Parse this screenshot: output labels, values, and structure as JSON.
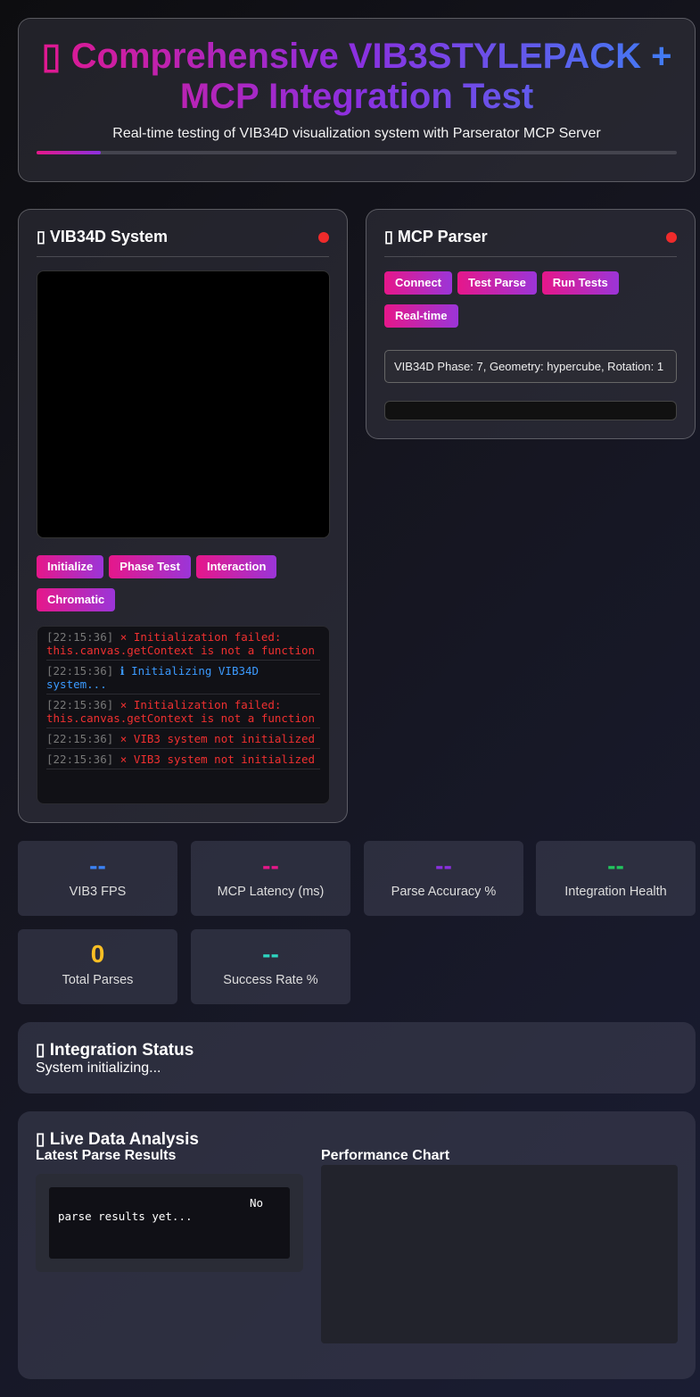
{
  "header": {
    "icon": "▯",
    "title": "Comprehensive VIB3STYLEPACK + MCP Integration Test",
    "subtitle": "Real-time testing of VIB34D visualization system with Parserator MCP Server",
    "progress_percent": 10
  },
  "vib": {
    "icon": "▯",
    "title": "VIB34D System",
    "status_color": "#ef2b2b",
    "buttons": [
      "Initialize",
      "Phase Test",
      "Interaction",
      "Chromatic"
    ],
    "log": [
      {
        "time": "[22:15:36]",
        "symbol": "×",
        "text": "Initialization failed: this.canvas.getContext is not a function",
        "type": "err"
      },
      {
        "time": "[22:15:36]",
        "symbol": "ℹ",
        "text": "Initializing VIB34D system...",
        "type": "info"
      },
      {
        "time": "[22:15:36]",
        "symbol": "×",
        "text": "Initialization failed: this.canvas.getContext is not a function",
        "type": "err"
      },
      {
        "time": "[22:15:36]",
        "symbol": "×",
        "text": "VIB3 system not initialized",
        "type": "err"
      },
      {
        "time": "[22:15:36]",
        "symbol": "×",
        "text": "VIB3 system not initialized",
        "type": "err"
      }
    ]
  },
  "mcp": {
    "icon": "▯",
    "title": "MCP Parser",
    "status_color": "#ef2b2b",
    "buttons": [
      "Connect",
      "Test Parse",
      "Run Tests",
      "Real-time"
    ],
    "input_value": "VIB34D Phase: 7, Geometry: hypercube, Rotation: 1"
  },
  "metrics": [
    {
      "value": "--",
      "label": "VIB3 FPS",
      "color": "#3b82f6"
    },
    {
      "value": "--",
      "label": "MCP Latency (ms)",
      "color": "#e6178a"
    },
    {
      "value": "--",
      "label": "Parse Accuracy %",
      "color": "#8b30e0"
    },
    {
      "value": "--",
      "label": "Integration Health",
      "color": "#22c55e"
    },
    {
      "value": "0",
      "label": "Total Parses",
      "color": "#fbbf24"
    },
    {
      "value": "--",
      "label": "Success Rate %",
      "color": "#2dd4bf"
    }
  ],
  "status": {
    "icon": "▯",
    "title": "Integration Status",
    "text": "System initializing..."
  },
  "analysis": {
    "icon": "▯",
    "title": "Live Data Analysis",
    "latest_title": "Latest Parse Results",
    "empty": "No parse results yet...",
    "chart_title": "Performance Chart"
  }
}
